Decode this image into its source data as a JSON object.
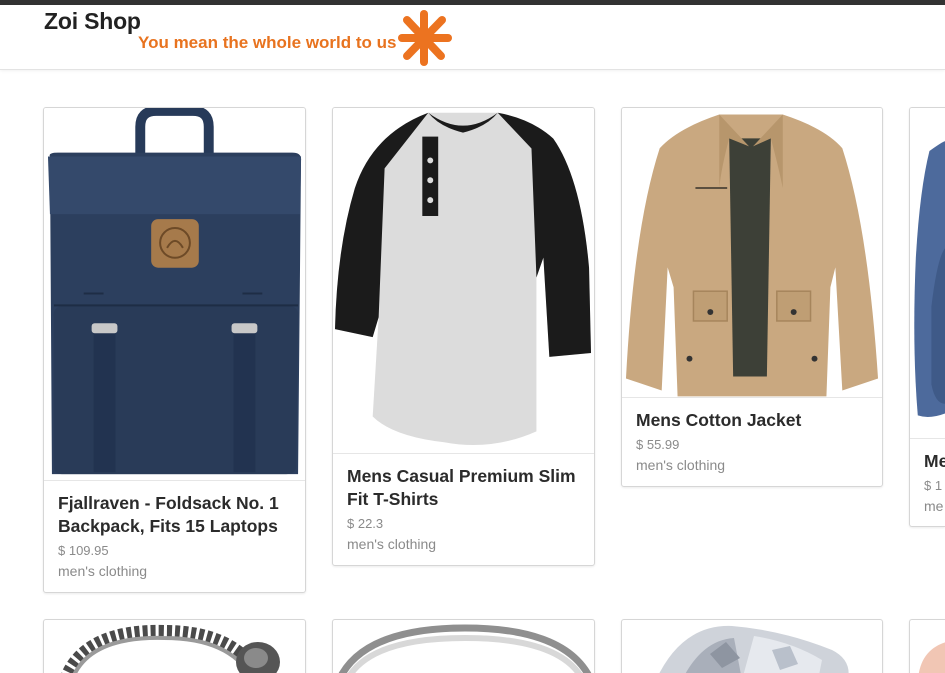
{
  "header": {
    "brand": "Zoi Shop",
    "tagline": "You mean the whole world to us",
    "logo_icon": "orange-asterisk-icon",
    "accent_color": "#e8731f"
  },
  "products": [
    {
      "title": "Fjallraven - Foldsack No. 1 Backpack, Fits 15 Laptops",
      "price": "$ 109.95",
      "category": "men's clothing",
      "image_icon": "navy-backpack-image"
    },
    {
      "title": "Mens Casual Premium Slim Fit T-Shirts",
      "price": "$ 22.3",
      "category": "men's clothing",
      "image_icon": "raglan-henley-tshirt-image"
    },
    {
      "title": "Mens Cotton Jacket",
      "price": "$ 55.99",
      "category": "men's clothing",
      "image_icon": "khaki-jacket-image"
    },
    {
      "title": "Me",
      "price": "$ 1",
      "category": "me",
      "image_icon": "blue-shirt-image"
    }
  ],
  "second_row_images": [
    "dragon-chain-bracelet-image",
    "silver-ring-image",
    "diamond-ring-image",
    "partial-product-image"
  ]
}
